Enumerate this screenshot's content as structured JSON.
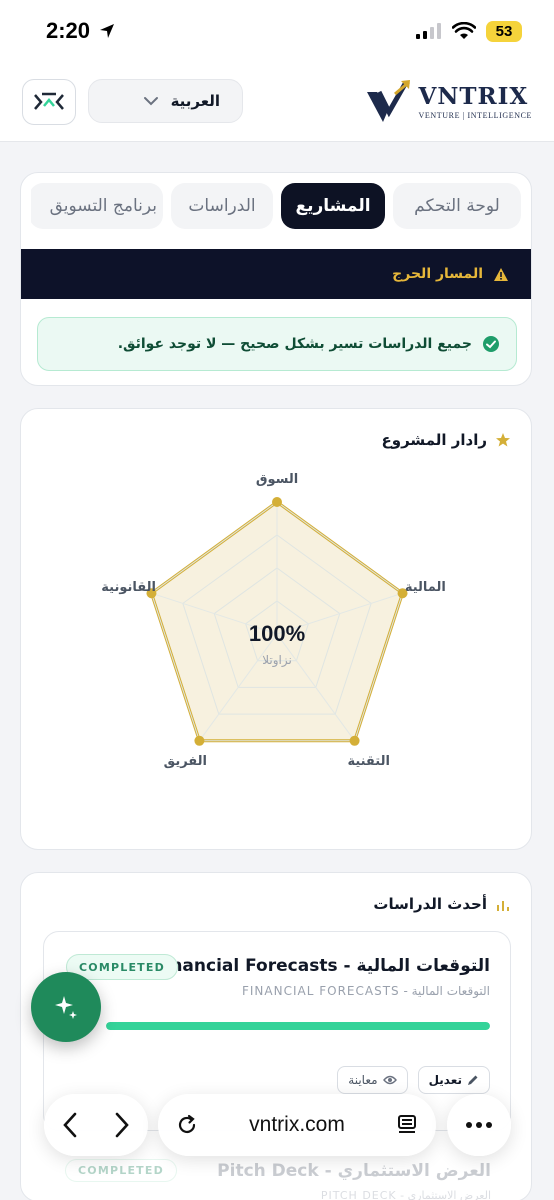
{
  "status_bar": {
    "time": "2:20",
    "battery": "53"
  },
  "header": {
    "language": "العربية",
    "logo_word": "VNTRIX",
    "logo_tagline": "VENTURE | INTELLIGENCE"
  },
  "tabs": [
    {
      "label": "لوحة التحكم",
      "active": false
    },
    {
      "label": "المشاريع",
      "active": true
    },
    {
      "label": "الدراسات",
      "active": false
    },
    {
      "label": "برنامج التسويق",
      "active": false
    }
  ],
  "critical_path": {
    "title": "المسار الحرج",
    "message": "جميع الدراسات تسير بشكل صحيح — لا توجد عوائق."
  },
  "radar": {
    "title": "رادار المشروع",
    "center_value": "100%",
    "center_label": "نزاوتلا",
    "colors": {
      "stroke": "#d4af37",
      "fill": "#f6efd9"
    }
  },
  "chart_data": {
    "type": "radar",
    "categories": [
      "السوق",
      "المالية",
      "التقنية",
      "الفريق",
      "القانونية"
    ],
    "values": [
      100,
      100,
      100,
      100,
      100
    ],
    "ylim": [
      0,
      100
    ],
    "grid": true
  },
  "studies": {
    "title": "أحدث الدراسات",
    "items": [
      {
        "title": "التوقعات المالية - Financial Forecasts",
        "subtitle": "التوقعات المالية - FINANCIAL FORECASTS",
        "status": "COMPLETED",
        "progress": 100,
        "edit_label": "تعديل",
        "preview_label": "معاينة"
      },
      {
        "title": "العرض الاستثماري - Pitch Deck",
        "subtitle": "العرض الاستثماري - PITCH DECK",
        "status": "COMPLETED"
      }
    ]
  },
  "browser": {
    "url": "vntrix.com"
  }
}
